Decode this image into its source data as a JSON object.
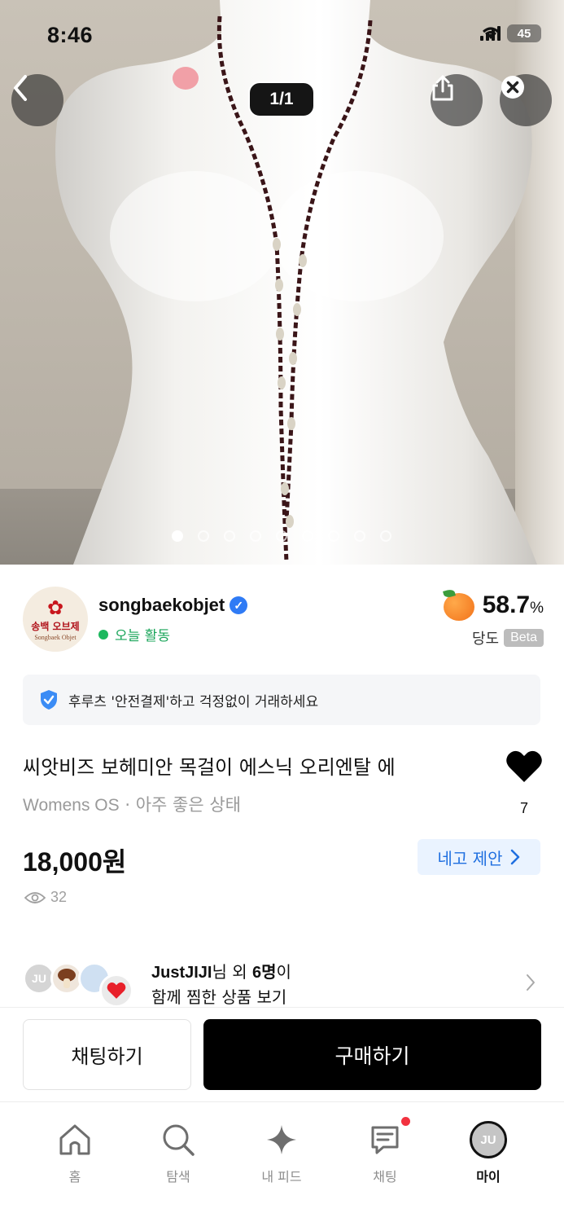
{
  "status_bar": {
    "time": "8:46",
    "battery": "45"
  },
  "gallery": {
    "pager": "1/1",
    "dot_count": 9,
    "active_dot": 0
  },
  "seller": {
    "name": "songbaekobjet",
    "logo_text_ko": "송백 오브제",
    "logo_text_en": "Songbaek Objet",
    "activity": "오늘 활동",
    "sweetness_value": "58.7",
    "sweetness_unit": "%",
    "sweetness_label": "당도",
    "beta_label": "Beta"
  },
  "safe_payment": {
    "text": "후루츠 '안전결제'하고 걱정없이 거래하세요"
  },
  "product": {
    "title": "씨앗비즈 보헤미안 목걸이 에스닉 오리엔탈 에",
    "brand": "Womens OS",
    "separator": "·",
    "condition": "아주 좋은 상태",
    "price": "18,000원",
    "offer_label": "네고 제안",
    "views": "32",
    "likes": "7"
  },
  "wishlist": {
    "avatar_initials": "JU",
    "user": "JustJIJI",
    "suffix1": "님 외 ",
    "count": "6명",
    "suffix2": "이",
    "line2": "함께 찜한 상품 보기"
  },
  "actions": {
    "chat": "채팅하기",
    "buy": "구매하기"
  },
  "tabs": [
    {
      "label": "홈",
      "icon": "home-icon"
    },
    {
      "label": "탐색",
      "icon": "search-icon"
    },
    {
      "label": "내 피드",
      "icon": "sparkle-icon"
    },
    {
      "label": "채팅",
      "icon": "chat-icon"
    },
    {
      "label": "마이",
      "icon": "profile-avatar",
      "initials": "JU"
    }
  ],
  "colors": {
    "accent_blue": "#2f7bf5",
    "active_green": "#1db85e",
    "notify_red": "#f2323f",
    "buy_black": "#000000"
  }
}
